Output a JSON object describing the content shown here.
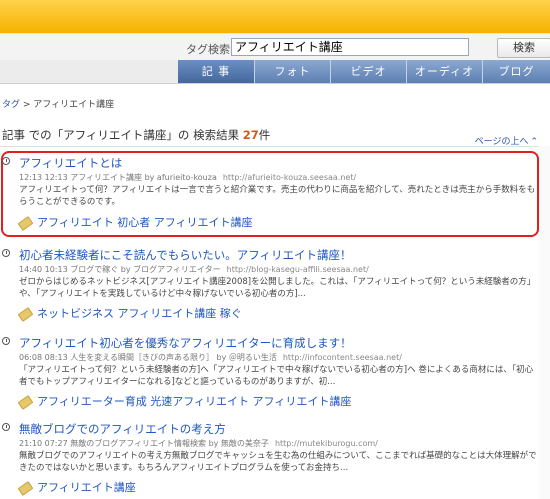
{
  "search": {
    "label": "タグ検索",
    "value": "アフィリエイト講座",
    "button_label": "検索"
  },
  "tabs": [
    {
      "label": "記 事",
      "active": true
    },
    {
      "label": "フォト",
      "active": false
    },
    {
      "label": "ビデオ",
      "active": false
    },
    {
      "label": "オーディオ",
      "active": false
    },
    {
      "label": "ブログ",
      "active": false
    }
  ],
  "breadcrumb": {
    "root": "タグ",
    "sep": " > ",
    "current": "アフィリエイト講座"
  },
  "results_header": {
    "prefix": "記事 での「アフィリエイト講座」の 検索結果 ",
    "count": "27",
    "suffix": "件",
    "page_top": "ページの上へ"
  },
  "results": [
    {
      "title": "アフィリエイトとは",
      "meta": "12:13 12:13 アフィリエイト講座 by afurieito-kouza",
      "url": "http://afurieito-kouza.seesaa.net/",
      "snippet": "アフィリエイトって何？アフィリエイトは一言で言うと紹介業です。売主の代わりに商品を紹介して、売れたときは売主から手数料をもらうことができるのです。",
      "tags": "アフィリエイト 初心者 アフィリエイト講座"
    },
    {
      "title": "初心者未経験者にこそ読んでもらいたい。アフィリエイト講座！",
      "meta": "14:40 10:13 ブログで稼ぐ by ブログアフィリエイター",
      "url": "http://blog-kasegu-affili.seesaa.net/",
      "snippet": "ゼロからはじめるネットビジネス[アフィリエイト講座2008]を公開しました。これは、「アフィリエイトって何？という未経験者の方」や、「アフィリエイトを実践しているけど中々稼げないでいる初心者の方]...",
      "tags": "ネットビジネス アフィリエイト講座 稼ぐ"
    },
    {
      "title": "アフィリエイト初心者を優秀なアフィリエイターに育成します！",
      "meta": "06:08 08:13 人生を変える瞬間［きびの声ある限り］ by ＠明るい生活",
      "url": "http://infocontent.seesaa.net/",
      "snippet": "「アフィリエイトって何？という未経験者の方]へ「アフィリエイトで中々稼げないでいる初心者の方]へ 巻によくある商材には、「初心者でもトップアフィリエイターになれる]などと謳っているものがありますが、初...",
      "tags": "アフィリエーター育成 光速アフィリエイト アフィリエイト講座"
    },
    {
      "title": "無敵ブログでのアフィリエイトの考え方",
      "meta": "21:10 07:27 無敵のブログアフィリエイト情報検索 by 無敵の美奈子",
      "url": "http://mutekiburogu.com/",
      "snippet": "無敵ブログでのアフィリエイトの考え方無敵ブログでキャッシュを生む為の仕組みについて、ここまでれば基礎的なことは大体理解ができたのではないかと思います。もちろんアフィリエイトプログラムを使ってお金持ち...",
      "tags": "アフィリエイト講座"
    }
  ]
}
